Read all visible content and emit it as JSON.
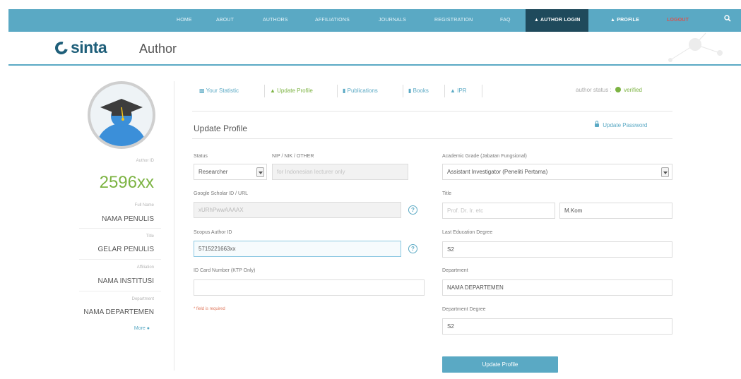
{
  "nav": {
    "items": [
      "HOME",
      "ABOUT",
      "AUTHORS",
      "AFFILIATIONS",
      "JOURNALS",
      "REGISTRATION",
      "FAQ"
    ],
    "author_login": "AUTHOR LOGIN",
    "profile": "PROFILE",
    "logout": "LOGOUT",
    "search_icon": "search-icon"
  },
  "header": {
    "logo": "sinta",
    "title": "Author"
  },
  "sidebar": {
    "author_id_label": "Author ID",
    "author_id": "2596xx",
    "full_name_label": "Full Name",
    "full_name": "NAMA PENULIS",
    "title_label": "Title",
    "title": "GELAR PENULIS",
    "affiliation_label": "Affiliation",
    "affiliation": "NAMA INSTITUSI",
    "department_label": "Department",
    "department": "NAMA DEPARTEMEN",
    "more": "More"
  },
  "tabs": [
    {
      "label": "Your Statistic",
      "icon": "chart-icon"
    },
    {
      "label": "Update Profile",
      "icon": "user-icon",
      "active": true
    },
    {
      "label": "Publications",
      "icon": "book-icon"
    },
    {
      "label": "Books",
      "icon": "books-icon"
    },
    {
      "label": "IPR",
      "icon": "trophy-icon"
    }
  ],
  "status": {
    "label": "author status :",
    "value": "verified"
  },
  "form": {
    "title": "Update Profile",
    "update_password": "Update Password",
    "status_label": "Status",
    "status_value": "Researcher",
    "nip_label": "NIP / NIK / OTHER",
    "nip_placeholder": "for Indonesian lecturer only",
    "scholar_label": "Google Scholar ID / URL",
    "scholar_value": "xURhPwwAAAAX",
    "scopus_label": "Scopus Author ID",
    "scopus_value": "5715221663xx",
    "idcard_label": "ID Card Number (KTP Only)",
    "idcard_value": "",
    "required_note": "* field is required",
    "academic_label": "Academic Grade (Jabatan Fungsional)",
    "academic_value": "Assistant Investigator (Peneliti Pertama)",
    "title_label": "Title",
    "title_prefix_placeholder": "Prof. Dr. Ir. etc",
    "title_suffix_value": "M.Kom",
    "last_edu_label": "Last Education Degree",
    "last_edu_value": "S2",
    "department_label": "Department",
    "department_value": "NAMA DEPARTEMEN",
    "dept_degree_label": "Department Degree",
    "dept_degree_value": "S2",
    "submit": "Update Profile"
  }
}
